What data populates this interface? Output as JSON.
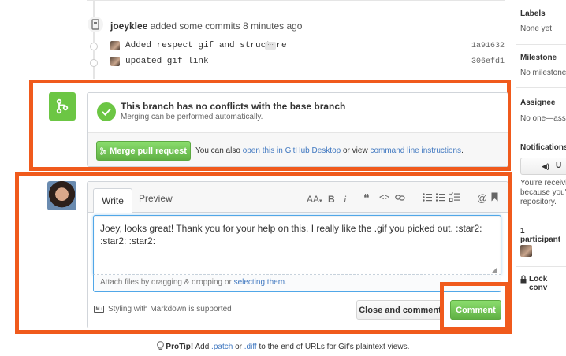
{
  "timeline": {
    "event_user": "joeyklee",
    "event_text": "added some commits 8 minutes ago",
    "commits": [
      {
        "message": "Added respect gif and structure",
        "sha": "1a91632",
        "has_ellipsis": true
      },
      {
        "message": "updated gif link",
        "sha": "306efd1",
        "has_ellipsis": false
      }
    ]
  },
  "merge": {
    "title": "This branch has no conflicts with the base branch",
    "subtitle": "Merging can be performed automatically.",
    "button_label": "Merge pull request",
    "alt_prefix": "You can also",
    "alt_link1": "open this in GitHub Desktop",
    "alt_mid": "or view",
    "alt_link2": "command line instructions",
    "alt_suffix": "."
  },
  "comment": {
    "tab_write": "Write",
    "tab_preview": "Preview",
    "toolbar": {
      "text_size": "AA",
      "bold": "B",
      "italic": "i"
    },
    "body": "Joey, looks great! Thank you for your help on this. I really like the .gif you picked out. :star2: :star2: :star2:",
    "attach_prefix": "Attach files by dragging & dropping or",
    "attach_link": "selecting them",
    "attach_suffix": ".",
    "markdown_note": "Styling with Markdown is supported",
    "markdown_badge": "M↓",
    "close_label": "Close and comment",
    "comment_label": "Comment"
  },
  "sidebar": {
    "labels_title": "Labels",
    "labels_value": "None yet",
    "milestone_title": "Milestone",
    "milestone_value": "No milestone",
    "assignee_title": "Assignee",
    "assignee_value": "No one—assig",
    "notifications_title": "Notifications",
    "unsubscribe_label": "U",
    "notif_line1": "You're receivin",
    "notif_line2": "because you're",
    "notif_line3": "repository.",
    "participants": "1 participant",
    "lock": "Lock conv"
  },
  "protip": {
    "label": "ProTip!",
    "text1": "Add",
    "ext1": ".patch",
    "text2": "or",
    "ext2": ".diff",
    "text3": "to the end of URLs for Git's plaintext views."
  },
  "colors": {
    "accent_green": "#6cc644",
    "highlight_orange": "#f05a1c",
    "link_blue": "#4078c0"
  }
}
